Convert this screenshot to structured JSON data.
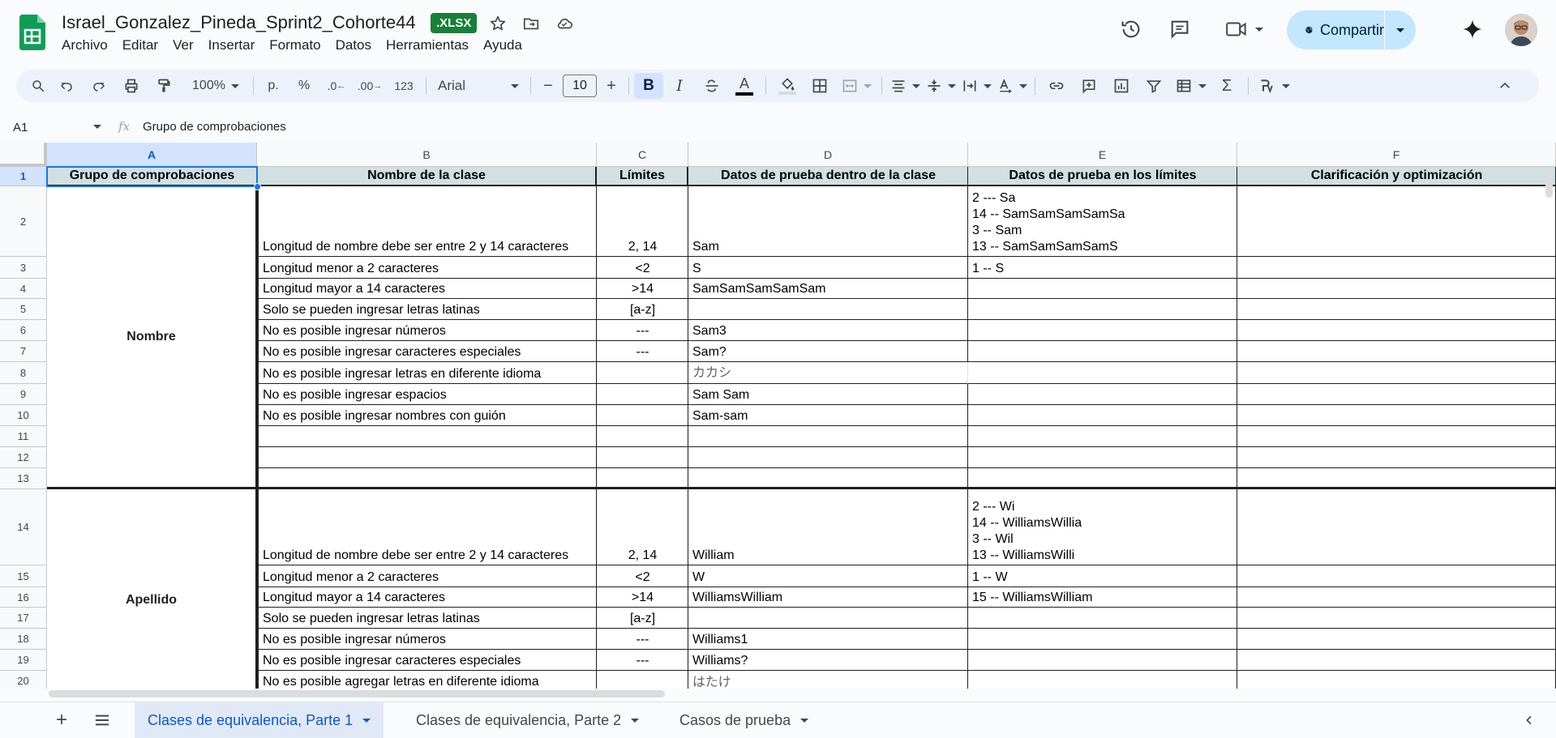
{
  "header": {
    "title": "Israel_Gonzalez_Pineda_Sprint2_Cohorte44",
    "badge": ".XLSX",
    "menu": [
      "Archivo",
      "Editar",
      "Ver",
      "Insertar",
      "Formato",
      "Datos",
      "Herramientas",
      "Ayuda"
    ],
    "share_label": "Compartir"
  },
  "toolbar": {
    "zoom": "100%",
    "currency": "p.",
    "percent": "%",
    "dec_decrease": ".0",
    "dec_increase": ".00",
    "number_format": "123",
    "font": "Arial",
    "font_size": "10",
    "bold": "B",
    "italic": "I",
    "text_color": "A"
  },
  "formula_bar": {
    "cell_ref": "A1",
    "fx": "fx",
    "content": "Grupo de comprobaciones"
  },
  "columns": [
    "A",
    "B",
    "C",
    "D",
    "E",
    "F"
  ],
  "rows": [
    "1",
    "2",
    "3",
    "4",
    "5",
    "6",
    "7",
    "8",
    "9",
    "10",
    "11",
    "12",
    "13",
    "14",
    "15",
    "16",
    "17",
    "18",
    "19",
    "20"
  ],
  "headers": {
    "a": "Grupo de comprobaciones",
    "b": "Nombre de la clase",
    "c": "Límites",
    "d": "Datos de prueba dentro de la clase",
    "e": "Datos de prueba en los límites",
    "f": "Clarificación y optimización"
  },
  "groups": {
    "nombre": "Nombre",
    "apellido": "Apellido"
  },
  "cells": {
    "b2": "Longitud de nombre debe ser entre 2 y 14 caracteres",
    "c2": "2, 14",
    "d2": "Sam",
    "e2": "2 --- Sa\n14 -- SamSamSamSamSa\n3 -- Sam\n13 -- SamSamSamSamS",
    "b3": "Longitud menor a 2 caracteres",
    "c3": "<2",
    "d3": "S",
    "e3": "1 -- S",
    "b4": "Longitud mayor a 14 caracteres",
    "c4": ">14",
    "d4": "SamSamSamSamSam",
    "b5": "Solo se pueden ingresar letras latinas",
    "c5": "[a-z]",
    "b6": "No es posible ingresar números",
    "c6": "---",
    "d6": "Sam3",
    "b7": "No es posible ingresar caracteres especiales",
    "c7": "---",
    "d7": "Sam?",
    "b8": "No es posible ingresar letras en diferente idioma",
    "d8": "カカシ",
    "b9": "No es posible ingresar espacios",
    "d9": "Sam Sam",
    "b10": "No es posible ingresar nombres con guión",
    "d10": "Sam-sam",
    "b14": "Longitud de nombre debe ser entre 2 y 14 caracteres",
    "c14": "2, 14",
    "d14": "William",
    "e14": "2 --- Wi\n14 -- WilliamsWillia\n3 -- Wil\n13 -- WilliamsWilli",
    "b15": "Longitud menor a 2 caracteres",
    "c15": "<2",
    "d15": "W",
    "e15": "1 -- W",
    "b16": "Longitud mayor a 14 caracteres",
    "c16": ">14",
    "d16": "WilliamsWilliam",
    "e16": "15 -- WilliamsWilliam",
    "b17": "Solo se pueden ingresar letras latinas",
    "c17": "[a-z]",
    "b18": "No es posible ingresar números",
    "c18": "---",
    "d18": "Williams1",
    "b19": "No es posible ingresar caracteres especiales",
    "c19": "---",
    "d19": "Williams?",
    "b20": "No es posible agregar letras en diferente idioma",
    "d20": "はたけ"
  },
  "sheets": [
    "Clases de equivalencia, Parte 1",
    "Clases de equivalencia, Parte 2",
    "Casos de prueba"
  ],
  "colors": {
    "accent": "#0b57d0",
    "share_bg": "#c2e7ff",
    "header_fill": "#d0e0e3",
    "badge": "#188038",
    "selection": "#1a73e8"
  }
}
